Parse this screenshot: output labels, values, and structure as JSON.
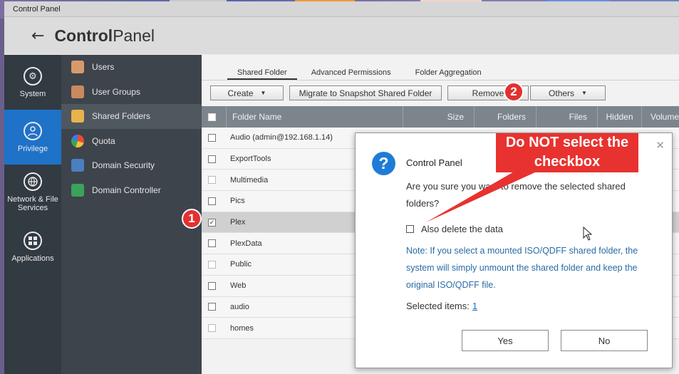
{
  "window": {
    "title": "Control Panel"
  },
  "header": {
    "back_icon": "back-arrow-icon",
    "title_bold": "Control",
    "title_rest": "Panel"
  },
  "categories": [
    {
      "label": "System",
      "icon": "gear-icon"
    },
    {
      "label": "Privilege",
      "icon": "user-icon",
      "active": true
    },
    {
      "label": "Network & File Services",
      "icon": "globe-icon"
    },
    {
      "label": "Applications",
      "icon": "grid-icon"
    }
  ],
  "submenu": [
    {
      "label": "Users",
      "icon": "user-icon"
    },
    {
      "label": "User Groups",
      "icon": "user-group-icon"
    },
    {
      "label": "Shared Folders",
      "icon": "folder-icon",
      "active": true
    },
    {
      "label": "Quota",
      "icon": "quota-icon"
    },
    {
      "label": "Domain Security",
      "icon": "domain-security-icon"
    },
    {
      "label": "Domain Controller",
      "icon": "domain-controller-icon"
    }
  ],
  "tabs": [
    {
      "label": "Shared Folder",
      "active": true
    },
    {
      "label": "Advanced Permissions"
    },
    {
      "label": "Folder Aggregation"
    }
  ],
  "toolbar": {
    "create_label": "Create",
    "migrate_label": "Migrate to Snapshot Shared Folder",
    "remove_label": "Remove",
    "others_label": "Others"
  },
  "table": {
    "headers": [
      "Folder Name",
      "Size",
      "Folders",
      "Files",
      "Hidden",
      "Volume"
    ],
    "rows": [
      {
        "name": "Audio (admin@192.168.1.14)",
        "checked": false,
        "selected": false
      },
      {
        "name": "ExportTools",
        "checked": false,
        "selected": false
      },
      {
        "name": "Multimedia",
        "checked": false,
        "selected": false,
        "dim": true
      },
      {
        "name": "Pics",
        "checked": false,
        "selected": false
      },
      {
        "name": "Plex",
        "checked": true,
        "selected": true
      },
      {
        "name": "PlexData",
        "checked": false,
        "selected": false
      },
      {
        "name": "Public",
        "checked": false,
        "selected": false,
        "dim": true
      },
      {
        "name": "Web",
        "checked": false,
        "selected": false
      },
      {
        "name": "audio",
        "checked": false,
        "selected": false
      },
      {
        "name": "homes",
        "checked": false,
        "selected": false,
        "dim": true
      }
    ]
  },
  "markers": {
    "one": "1",
    "two": "2"
  },
  "dialog": {
    "title": "Control Panel",
    "message": "Are you sure you want to remove the selected shared folders?",
    "checkbox_label": "Also delete the data",
    "note": "Note: If you select a mounted ISO/QDFF shared folder, the system will simply unmount the shared folder and keep the original ISO/QDFF file.",
    "selected_label": "Selected items:",
    "selected_count": "1",
    "yes_label": "Yes",
    "no_label": "No"
  },
  "annotation": {
    "text": "Do NOT select the checkbox",
    "color": "#e8322f"
  },
  "colors": {
    "accent": "#1e72c8",
    "sidebar": "#323a42",
    "submenu": "#3d444c",
    "header_row": "#7d858c",
    "note": "#2a6aa6"
  }
}
